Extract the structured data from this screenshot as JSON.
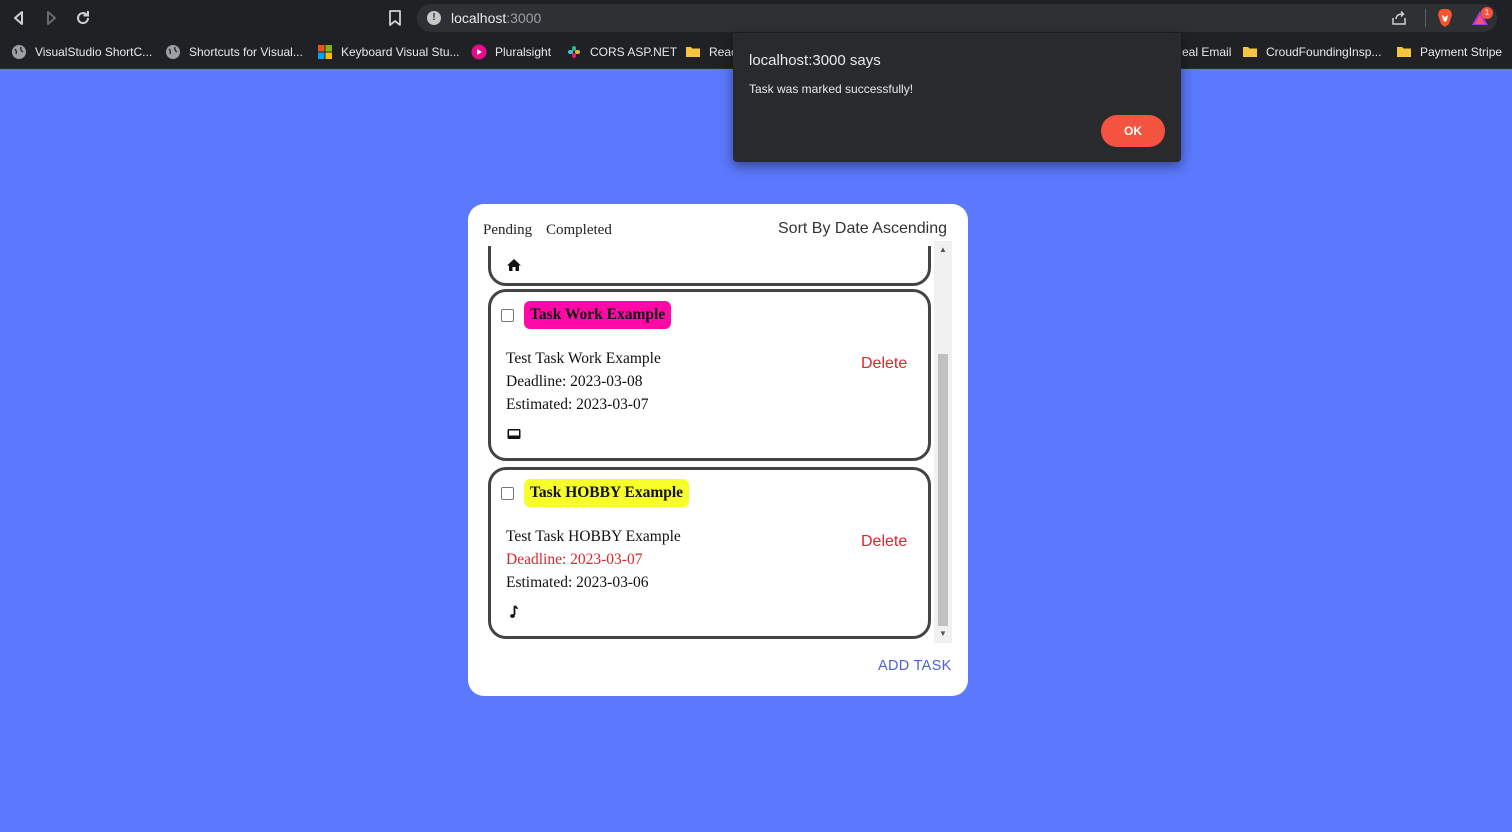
{
  "browser": {
    "url_host": "localhost",
    "url_port": ":3000",
    "rewards_count": "1",
    "bookmarks": [
      {
        "label": "VisualStudio ShortC...",
        "icon": "globe-icon"
      },
      {
        "label": "Shortcuts for Visual...",
        "icon": "globe-icon"
      },
      {
        "label": "Keyboard Visual Stu...",
        "icon": "microsoft-icon"
      },
      {
        "label": "Pluralsight",
        "icon": "pluralsight-icon"
      },
      {
        "label": "CORS ASP.NET",
        "icon": "slack-icon"
      },
      {
        "label": "Reac",
        "icon": "folder-icon"
      },
      {
        "label": "eal Email",
        "icon": "folder-icon"
      },
      {
        "label": "CroudFoundingInsp...",
        "icon": "folder-icon"
      },
      {
        "label": "Payment Stripe",
        "icon": "folder-icon"
      }
    ]
  },
  "dialog": {
    "title": "localhost:3000 says",
    "message": "Task was marked successfully!",
    "ok_label": "OK"
  },
  "app": {
    "tabs": [
      "Pending",
      "Completed"
    ],
    "sort_label": "Sort By Date Ascending",
    "add_task_label": "ADD TASK",
    "previous_task_icon": "home-icon",
    "tasks": [
      {
        "title": "Task Work Example",
        "tag_color": "#ff0aa6",
        "description": "Test Task Work Example",
        "deadline": "Deadline: 2023-03-08",
        "estimated": "Estimated: 2023-03-07",
        "deadline_overdue": false,
        "delete_label": "Delete",
        "category_icon": "inbox-icon"
      },
      {
        "title": "Task HOBBY Example",
        "tag_color": "#f6ff2a",
        "description": "Test Task HOBBY Example",
        "deadline": "Deadline: 2023-03-07",
        "estimated": "Estimated: 2023-03-06",
        "deadline_overdue": true,
        "delete_label": "Delete",
        "category_icon": "music-note-icon"
      }
    ]
  }
}
